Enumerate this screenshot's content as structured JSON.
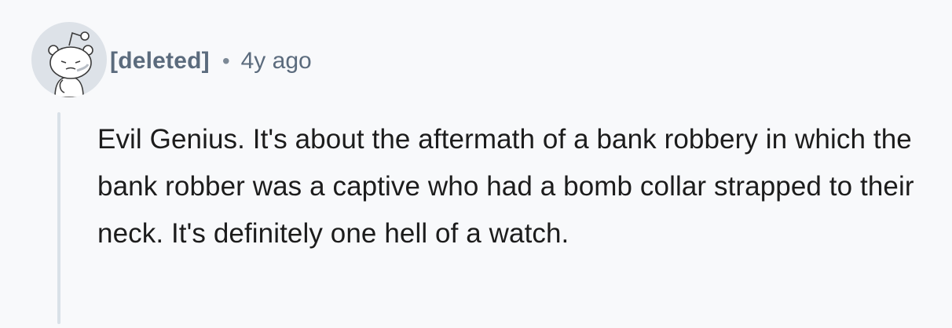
{
  "comment": {
    "avatar_icon": "snoo-avatar-icon",
    "author": "[deleted]",
    "separator": "•",
    "timestamp": "4y ago",
    "body": "Evil Genius. It's about the aftermath of a bank robbery in which the bank robber was a captive who had a bomb collar strapped to their neck. It's definitely one hell of a watch."
  },
  "colors": {
    "background": "#f8f9fb",
    "meta_text": "#5b6b7d",
    "body_text": "#1c1c1c",
    "thread_line": "#d9e1e8",
    "avatar_bg": "#dde2e8"
  }
}
